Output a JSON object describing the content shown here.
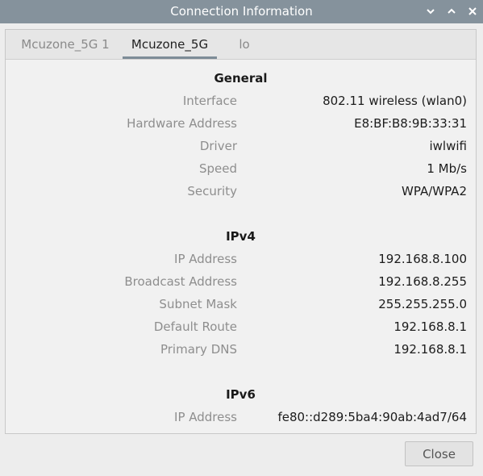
{
  "window": {
    "title": "Connection Information"
  },
  "tabs": [
    {
      "label": "Mcuzone_5G 1",
      "active": false
    },
    {
      "label": "Mcuzone_5G",
      "active": true
    },
    {
      "label": "lo",
      "active": false
    }
  ],
  "general": {
    "heading": "General",
    "rows": [
      {
        "label": "Interface",
        "value": "802.11 wireless (wlan0)"
      },
      {
        "label": "Hardware Address",
        "value": "E8:BF:B8:9B:33:31"
      },
      {
        "label": "Driver",
        "value": "iwlwifi"
      },
      {
        "label": "Speed",
        "value": "1 Mb/s"
      },
      {
        "label": "Security",
        "value": "WPA/WPA2"
      }
    ]
  },
  "ipv4": {
    "heading": "IPv4",
    "rows": [
      {
        "label": "IP Address",
        "value": "192.168.8.100"
      },
      {
        "label": "Broadcast Address",
        "value": "192.168.8.255"
      },
      {
        "label": "Subnet Mask",
        "value": "255.255.255.0"
      },
      {
        "label": "Default Route",
        "value": "192.168.8.1"
      },
      {
        "label": "Primary DNS",
        "value": "192.168.8.1"
      }
    ]
  },
  "ipv6": {
    "heading": "IPv6",
    "rows": [
      {
        "label": "IP Address",
        "value": "fe80::d289:5ba4:90ab:4ad7/64"
      }
    ]
  },
  "footer": {
    "close_label": "Close"
  },
  "icons": {
    "minimize": "chevron-down-icon",
    "maximize": "chevron-up-icon",
    "close": "close-icon"
  },
  "colors": {
    "titlebar": "#85929c",
    "tab_underline": "#7d8c97"
  }
}
